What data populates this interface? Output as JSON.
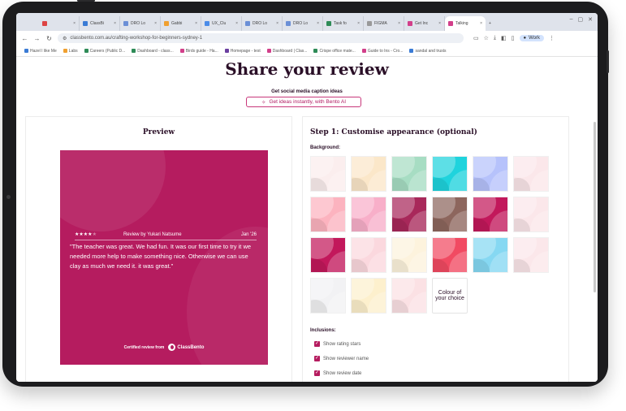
{
  "browser": {
    "tabs": [
      {
        "label": "",
        "color": "#d44"
      },
      {
        "label": "ClassBi",
        "color": "#3a7bd5"
      },
      {
        "label": "DRO Lo",
        "color": "#6b8fd6"
      },
      {
        "label": "Gabbi",
        "color": "#f0a030"
      },
      {
        "label": "UX_Clu",
        "color": "#4a8be8"
      },
      {
        "label": "DRO Lo",
        "color": "#6b8fd6"
      },
      {
        "label": "DRO Lo",
        "color": "#6b8fd6"
      },
      {
        "label": "Task fo",
        "color": "#2e8b57"
      },
      {
        "label": "FIGMA",
        "color": "#999999"
      },
      {
        "label": "Get Inc",
        "color": "#d23f8a"
      },
      {
        "label": "Talking",
        "color": "#d23f8a"
      }
    ],
    "url": "classbento.com.au/crafting-workshop-for-beginners-sydney-1",
    "profile": "Work",
    "bookmarks": [
      {
        "label": "Hazel I like Me",
        "color": "#3a7bd5"
      },
      {
        "label": "Labs",
        "color": "#f0a030"
      },
      {
        "label": "Careers (Public D...",
        "color": "#2e8b57"
      },
      {
        "label": "Dashboard - class...",
        "color": "#2e8b57"
      },
      {
        "label": "Birds guide - Ha...",
        "color": "#d23f8a"
      },
      {
        "label": "Homepage - test",
        "color": "#6b3fa0"
      },
      {
        "label": "Dashboard | Clas...",
        "color": "#d23f8a"
      },
      {
        "label": "Crispe office mate...",
        "color": "#2e8b57"
      },
      {
        "label": "Guide to Ins - Cro...",
        "color": "#d23f8a"
      },
      {
        "label": "sandal and trusts",
        "color": "#3a7bd5"
      }
    ]
  },
  "page": {
    "title": "Share your review",
    "ideas_label": "Get social media caption ideas",
    "ideas_button": "Get ideas instantly, with Bento AI"
  },
  "preview": {
    "heading": "Preview",
    "card_color": "#b51c5f",
    "rating": 4,
    "rating_max": 5,
    "reviewer": "Review by Yukari Natsume",
    "date": "Jan '26",
    "quote": "\"The teacher was great. We had fun. It was our first time to try it we needed more help to make something nice. Otherwise we can use clay as much we need it. it was great.\"",
    "certified_label": "Certified review from",
    "brand": "ClassBento"
  },
  "customise": {
    "heading": "Step 1: Customise appearance (optional)",
    "background_label": "Background:",
    "backgrounds": [
      "#fbeeee",
      "#fbe7c9",
      "#a7ddc3",
      "#1fd3dd",
      "#b6c2fb",
      "#fbe7ea",
      "#fcb3bf",
      "#f8afc9",
      "#a8285a",
      "#8d665d",
      "#c2185b",
      "#fbe7ea",
      "#c2185b",
      "#fbd8de",
      "#fdf3dd",
      "#f14a62",
      "#86d8f2",
      "#fbe7ea",
      "#f2f2f4",
      "#fdf0cd",
      "#fbe1e4"
    ],
    "custom_label": "Colour of your choice",
    "inclusions_label": "Inclusions:",
    "inclusions": [
      {
        "label": "Show rating stars",
        "checked": true
      },
      {
        "label": "Show reviewer name",
        "checked": true
      },
      {
        "label": "Show review date",
        "checked": true
      }
    ]
  }
}
